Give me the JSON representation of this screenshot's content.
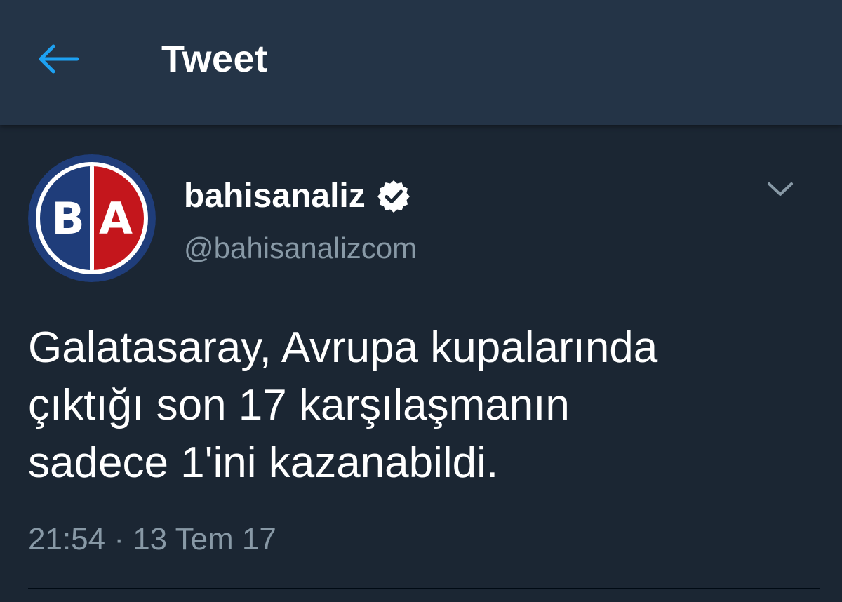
{
  "header": {
    "title": "Tweet",
    "back_icon": "arrow-left-icon"
  },
  "tweet": {
    "author": {
      "display_name": "bahisanaliz",
      "handle": "@bahisanalizcom",
      "verified": true,
      "verified_icon": "verified-badge-icon",
      "avatar_letters": [
        "B",
        "A"
      ]
    },
    "text": "Galatasaray, Avrupa kupalarında\nçıktığı son 17 karşılaşmanın\nsadece 1'ini kazanabildi.",
    "timestamp": "21:54 · 13 Tem 17",
    "menu_icon": "chevron-down-icon"
  },
  "colors": {
    "background": "#1b2633",
    "header_bg": "#243447",
    "accent": "#1da1f2",
    "secondary_text": "#8899a6",
    "avatar_blue": "#1f3d7a",
    "avatar_red": "#c4161c"
  }
}
